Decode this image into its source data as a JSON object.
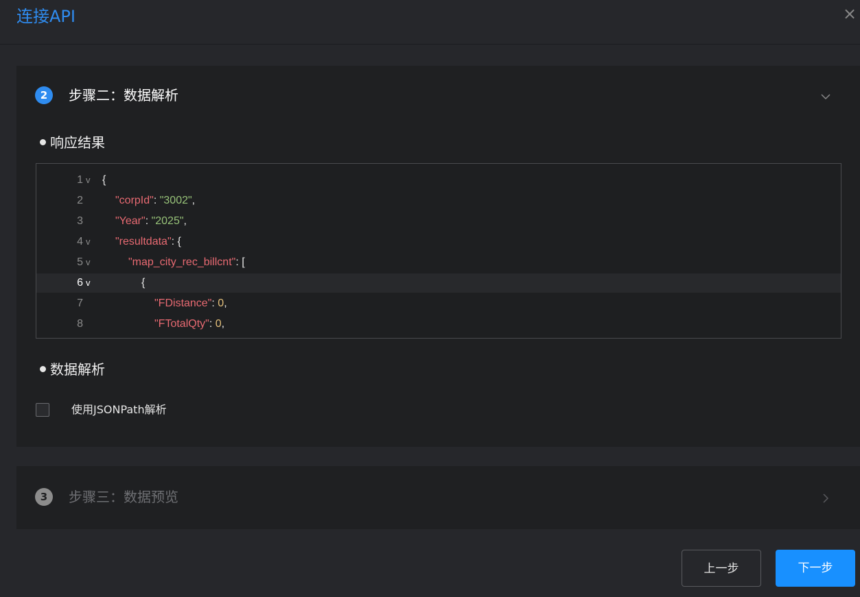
{
  "dialog": {
    "title": "连接API",
    "close_icon": "×"
  },
  "step2": {
    "number": "2",
    "title": "步骤二：数据解析",
    "badge_color": "#2f8cf0",
    "chevron_icon": "chevron-down-icon"
  },
  "response_section": {
    "label": "响应结果"
  },
  "code_lines": [
    {
      "number": "1",
      "fold": "v",
      "text": "{"
    },
    {
      "number": "2",
      "fold": "",
      "key": "\"corpId\"",
      "sep": ": ",
      "value": "\"3002\"",
      "value_type": "str",
      "tail": ","
    },
    {
      "number": "3",
      "fold": "",
      "key": "\"Year\"",
      "sep": ": ",
      "value": "\"2025\"",
      "value_type": "str",
      "tail": ","
    },
    {
      "number": "4",
      "fold": "v",
      "key": "\"resultdata\"",
      "sep": ": ",
      "value": "{",
      "value_type": "punc",
      "tail": ""
    },
    {
      "number": "5",
      "fold": "v",
      "key": "\"map_city_rec_billcnt\"",
      "sep": ": ",
      "value": "[",
      "value_type": "punc",
      "tail": ""
    },
    {
      "number": "6",
      "fold": "v",
      "text": "{"
    },
    {
      "number": "7",
      "fold": "",
      "key": "\"FDistance\"",
      "sep": ": ",
      "value": "0",
      "value_type": "num",
      "tail": ","
    },
    {
      "number": "8",
      "fold": "",
      "key": "\"FTotalQty\"",
      "sep": ": ",
      "value": "0",
      "value_type": "num",
      "tail": ","
    }
  ],
  "parse_section": {
    "label": "数据解析",
    "jsonpath_checkbox_label": "使用JSONPath解析",
    "jsonpath_checked": false
  },
  "step3": {
    "number": "3",
    "title": "步骤三：数据预览",
    "badge_color": "#8c8c8c",
    "chevron_icon": "chevron-right-icon"
  },
  "footer": {
    "prev_label": "上一步",
    "next_label": "下一步"
  }
}
